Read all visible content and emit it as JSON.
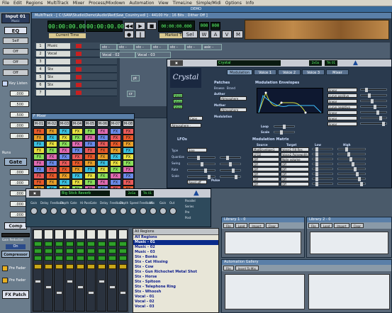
{
  "menubar": {
    "items": [
      "File",
      "Edit",
      "Regions",
      "MultiTrack",
      "Mixer",
      "Process/Mixdown",
      "Automation",
      "View",
      "TimeLine",
      "Simple/Midi",
      "Options",
      "Info"
    ]
  },
  "title_strip": "DEMO",
  "left_strip": {
    "title": "Input 01",
    "subtitle": "Music",
    "eq_label": "EQ",
    "buttons": [
      "Self",
      "Off",
      "Off",
      "Off"
    ],
    "key_listen": "Key Listen",
    "values": [
      ".000",
      ".500",
      ".500",
      ".000",
      ".000"
    ],
    "runs": "Runs",
    "gate": "Gate",
    "values2": [
      ".000",
      ".000",
      ".000",
      ".000",
      ".000"
    ],
    "comp_label": "Comp",
    "gain_reduction": "Gain Reduction",
    "on": "On",
    "compressor": "Compressor",
    "pre_fader": "Pre Fader",
    "pre_fader2": "Pre Fader",
    "fx_patch": "FX Patch"
  },
  "multitrack": {
    "title": "MultiTrack - [ C:\\SAW\\Studio\\Demo\\Audio\\Red\\Saw_Country.edl ] - 44100 Hz ; 16 Bits ; Dither Off ]",
    "time1": "00:00:00.000",
    "time2": "00:00:00.000",
    "current_time": "Current Time",
    "marked_time": "Marked Time",
    "marked_lcd": "00:00:00.000",
    "counter1": "000",
    "counter2": "000",
    "tracks": [
      {
        "num": "1",
        "name": "Music"
      },
      {
        "num": "2",
        "name": "Vocal"
      },
      {
        "num": "3",
        "name": ""
      },
      {
        "num": "4",
        "name": "Stx"
      },
      {
        "num": "5",
        "name": "Stx"
      },
      {
        "num": "6",
        "name": "Stx"
      },
      {
        "num": "7",
        "name": ""
      }
    ],
    "clips": [
      "stc - ",
      "stc - ",
      "stc - ",
      "stc - ",
      "stc - ",
      "stc - ",
      "stc - ",
      "stc - ",
      "stc - ",
      "stc - ",
      "stc - ",
      "stc - ",
      "stc - ",
      "stc - ",
      "stc - ",
      "stc - ",
      "stc - ",
      "stc - ",
      "stc - ",
      "stc - ",
      "stc - ",
      "stc - ",
      "stc - ",
      "stc - ",
      "stc - ",
      "stc - ",
      "stc - ",
      "stc - ",
      "stc - ",
      "stc - ",
      "stc - ",
      "stc - ",
      "stc - ",
      "stc - ",
      "stc - ",
      "stc - ",
      "stc - ",
      "stc - ",
      "stc - ",
      "stc - "
    ],
    "clip_row1": [
      "stc - ",
      "stc - ",
      "stc - ",
      "stc - ",
      "stc - ",
      "stc - ",
      "asic - "
    ],
    "clip_row2": [
      "Vocal - 02",
      "Vocal - 03"
    ],
    "clip_row3": [
      "pt",
      "sf"
    ],
    "clip_row4": [
      "la"
    ],
    "clip_row5": [
      "cr",
      "",
      ""
    ]
  },
  "crystal": {
    "title_lcd": "Crystal",
    "channel": "2xGo",
    "track": "Trk 01",
    "logo": "Crystal",
    "tabs": [
      "Modulation",
      "Voice 1",
      "Voice 2",
      "Voice 3",
      "Mixer"
    ],
    "patches": "Patches",
    "browse": "Browse",
    "brand": "Brand",
    "author": "Author",
    "author_val": "Atmosphere",
    "mother": "Mother",
    "mother_val": "Atmosphere",
    "modulation": "Modulation",
    "copy": "Copy",
    "atmosphere_drop": "Atmosphere -",
    "voices": [
      "Voice 1",
      "Voice 2",
      "Voice 3"
    ],
    "mod_env_title": "Modulation Envelopes",
    "env_list": [
      "linear",
      "curve positive",
      "linear",
      "curve negative",
      "linear",
      "linear",
      "linear"
    ],
    "loop_label": "Loop",
    "scale_label": "Scale",
    "lfos_title": "LFOs",
    "lfo_rows": [
      "Type",
      "Quantize",
      "Swing",
      "Rate",
      "Scale"
    ],
    "lfo_type": "Sine",
    "lfo_reset": "Reset off",
    "pulse": "Pulse",
    "mod_matrix": "Modulation Matrix",
    "source_hdr": "Source",
    "target_hdr": "Target",
    "low_hdr": "Low",
    "high_hdr": "High",
    "sources": [
      "ModEnvelope1",
      "LFO2",
      "Off",
      "Off",
      "Off",
      "Off",
      "Off",
      "Off"
    ],
    "targets": [
      "Voice1 Filt Res",
      "Voice2 Pulsewidth",
      "Note volume",
      "Off",
      "Off",
      "Off",
      "Off",
      "Off"
    ]
  },
  "mixer": {
    "title": "F Mixer",
    "headers": [
      "M-01",
      "M-02",
      "M-03",
      "M-04",
      "M-05",
      "M-06",
      "M-07",
      "M-08"
    ],
    "row_labels": [
      "FX",
      "FX",
      "FX",
      "FX",
      "FX",
      "FX",
      "FX",
      "FX"
    ]
  },
  "reverb": {
    "title_lcd": "Big Stick Reverb",
    "channel": "2xGo",
    "track": "Trk 01",
    "knob_labels": [
      "Gain",
      "Delay",
      "Feedback",
      "Depth",
      "Gate",
      "Hi-Pass",
      "Gate",
      "Delay",
      "Feedback",
      "Depth",
      "Speed",
      "Feedback",
      "Mix",
      "Gain",
      "Out"
    ],
    "options": [
      "Parallel",
      "Series",
      "Pre",
      "Post"
    ]
  },
  "regions": {
    "header": "All Regions",
    "items": [
      "All Regions",
      "Music - 01",
      "Music - 02",
      "Music - 03",
      "Stx - Bonks",
      "Stx - Cat Hissing",
      "Stx - Cow",
      "Stx - Gun Richochet Metal Shot",
      "Stx - Horse",
      "Stx - Spitoon",
      "Stx - Telephone Ring",
      "Stx - Whoosh",
      "Vocal - 01",
      "Vocal - 02",
      "Vocal - 03"
    ],
    "selected_index": 1
  },
  "library1": {
    "title": "Library 1 - 0",
    "buttons": [
      "File",
      "Load",
      "Import",
      "Clear"
    ]
  },
  "library2": {
    "title": "Library 2 - 0",
    "buttons": [
      "File",
      "Load",
      "Import",
      "Clear"
    ]
  },
  "autogallery": {
    "title": "Automation Gallery",
    "buttons": [
      "File",
      "Insert To Mix"
    ]
  },
  "colors": {
    "accent": "#5a7fa8",
    "lcd_green": "#5cff6a",
    "rec_red": "#c82020"
  }
}
